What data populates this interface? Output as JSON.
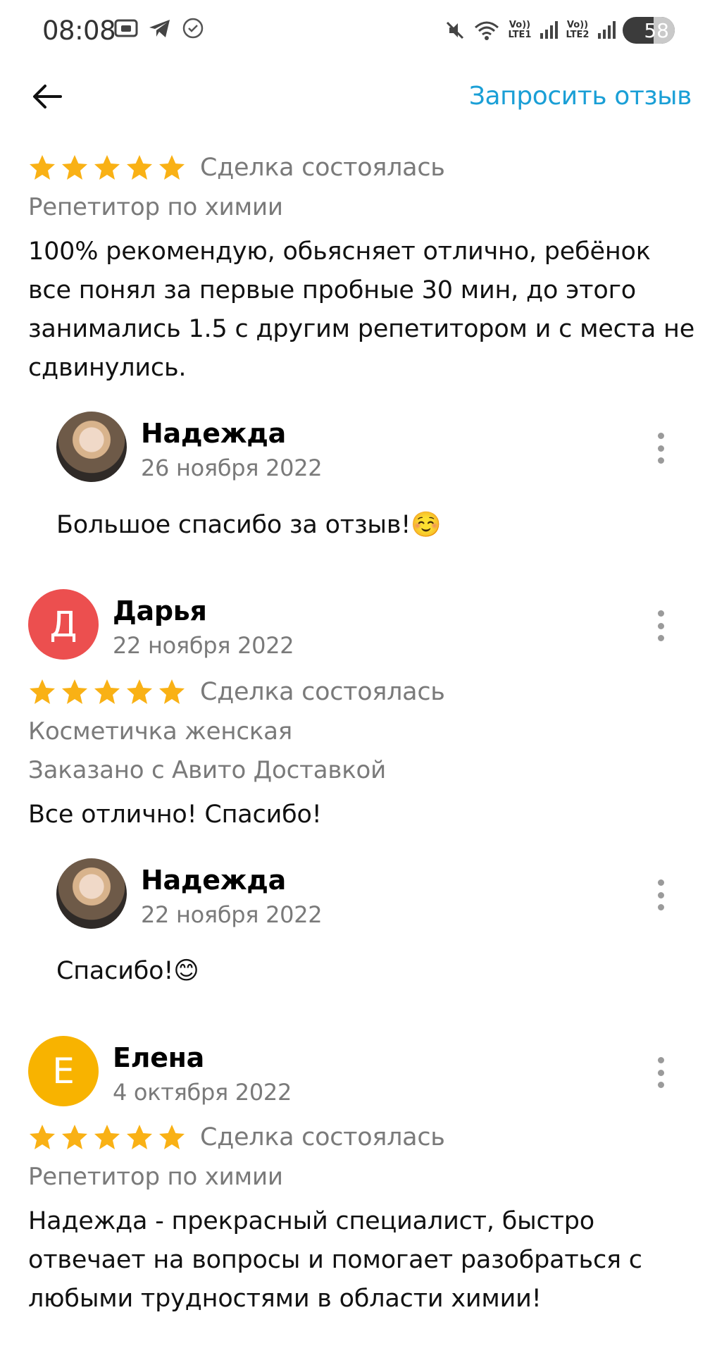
{
  "status_bar": {
    "time": "08:08",
    "volte1": "Vo)) LTE1",
    "volte2": "Vo)) LTE2",
    "battery": "58"
  },
  "header": {
    "back_icon": "arrow-left-icon",
    "request_label": "Запросить отзыв"
  },
  "colors": {
    "accent": "#1a9fd6",
    "star": "#f9b115",
    "avatar_d": "#ec4f4f",
    "avatar_e": "#f8b300"
  },
  "reviews": [
    {
      "rating": 5,
      "deal": "Сделка состоялась",
      "item": "Репетитор по химии",
      "text": "100% рекомендую, обьясняет отлично, ребёнок все понял за первые пробные 30 мин, до этого занимались 1.5 с другим репетитором и с места не сдвинулись.",
      "reply": {
        "name": "Надежда",
        "date": "26 ноября 2022",
        "text": "Большое спасибо за отзыв!☺️"
      }
    },
    {
      "author": "Дарья",
      "initial": "Д",
      "date": "22 ноября 2022",
      "rating": 5,
      "deal": "Сделка состоялась",
      "item": "Косметичка женская",
      "delivery": "Заказано с Авито Доставкой",
      "text": "Все отлично! Спасибо!",
      "reply": {
        "name": "Надежда",
        "date": "22 ноября 2022",
        "text": "Спасибо!😊"
      }
    },
    {
      "author": "Елена",
      "initial": "Е",
      "date": "4 октября 2022",
      "rating": 5,
      "deal": "Сделка состоялась",
      "item": "Репетитор по химии",
      "text": "Надежда - прекрасный специалист, быстро отвечает на вопросы и помогает разобраться с любыми трудностями в области химии!"
    }
  ]
}
